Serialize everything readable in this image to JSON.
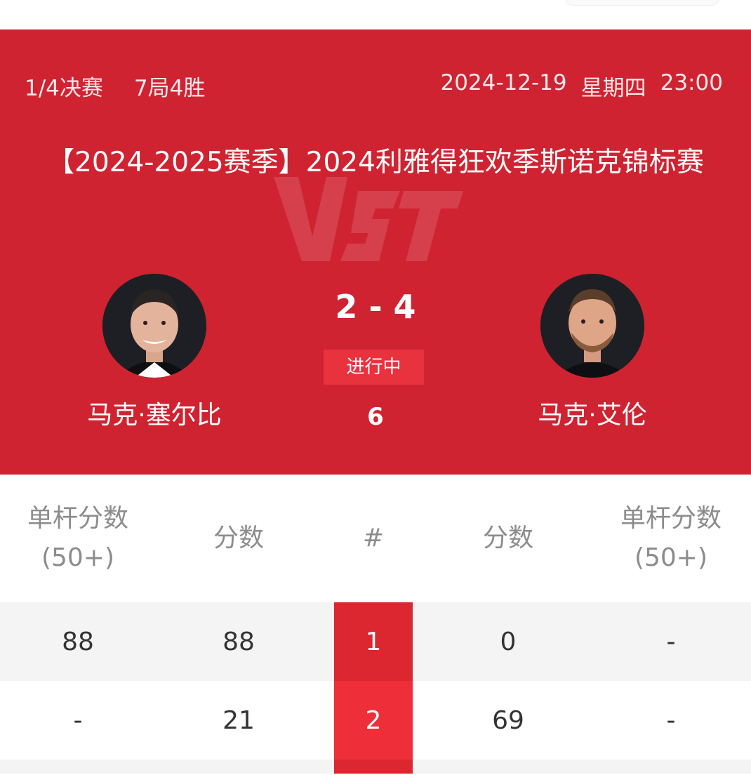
{
  "match": {
    "round": "1/4决赛",
    "format": "7局4胜",
    "date": "2024-12-19",
    "weekday": "星期四",
    "time": "23:00",
    "title": "【2024-2025赛季】2024利雅得狂欢季斯诺克锦标赛",
    "score": "2 - 4",
    "status": "进行中",
    "current_frame": "6",
    "hero_color": "#cf2331"
  },
  "players": {
    "left": {
      "name": "马克·塞尔比"
    },
    "right": {
      "name": "马克·艾伦"
    }
  },
  "table": {
    "headers": {
      "left_break": "单杆分数\n(50+)",
      "left_score": "分数",
      "frame": "#",
      "right_score": "分数",
      "right_break": "单杆分数\n(50+)"
    },
    "rows": [
      {
        "left_break": "88",
        "left_score": "88",
        "frame": "1",
        "right_score": "0",
        "right_break": "-"
      },
      {
        "left_break": "-",
        "left_score": "21",
        "frame": "2",
        "right_score": "69",
        "right_break": "-"
      },
      {
        "left_break": "",
        "left_score": "",
        "frame": "",
        "right_score": "",
        "right_break": ""
      }
    ]
  }
}
